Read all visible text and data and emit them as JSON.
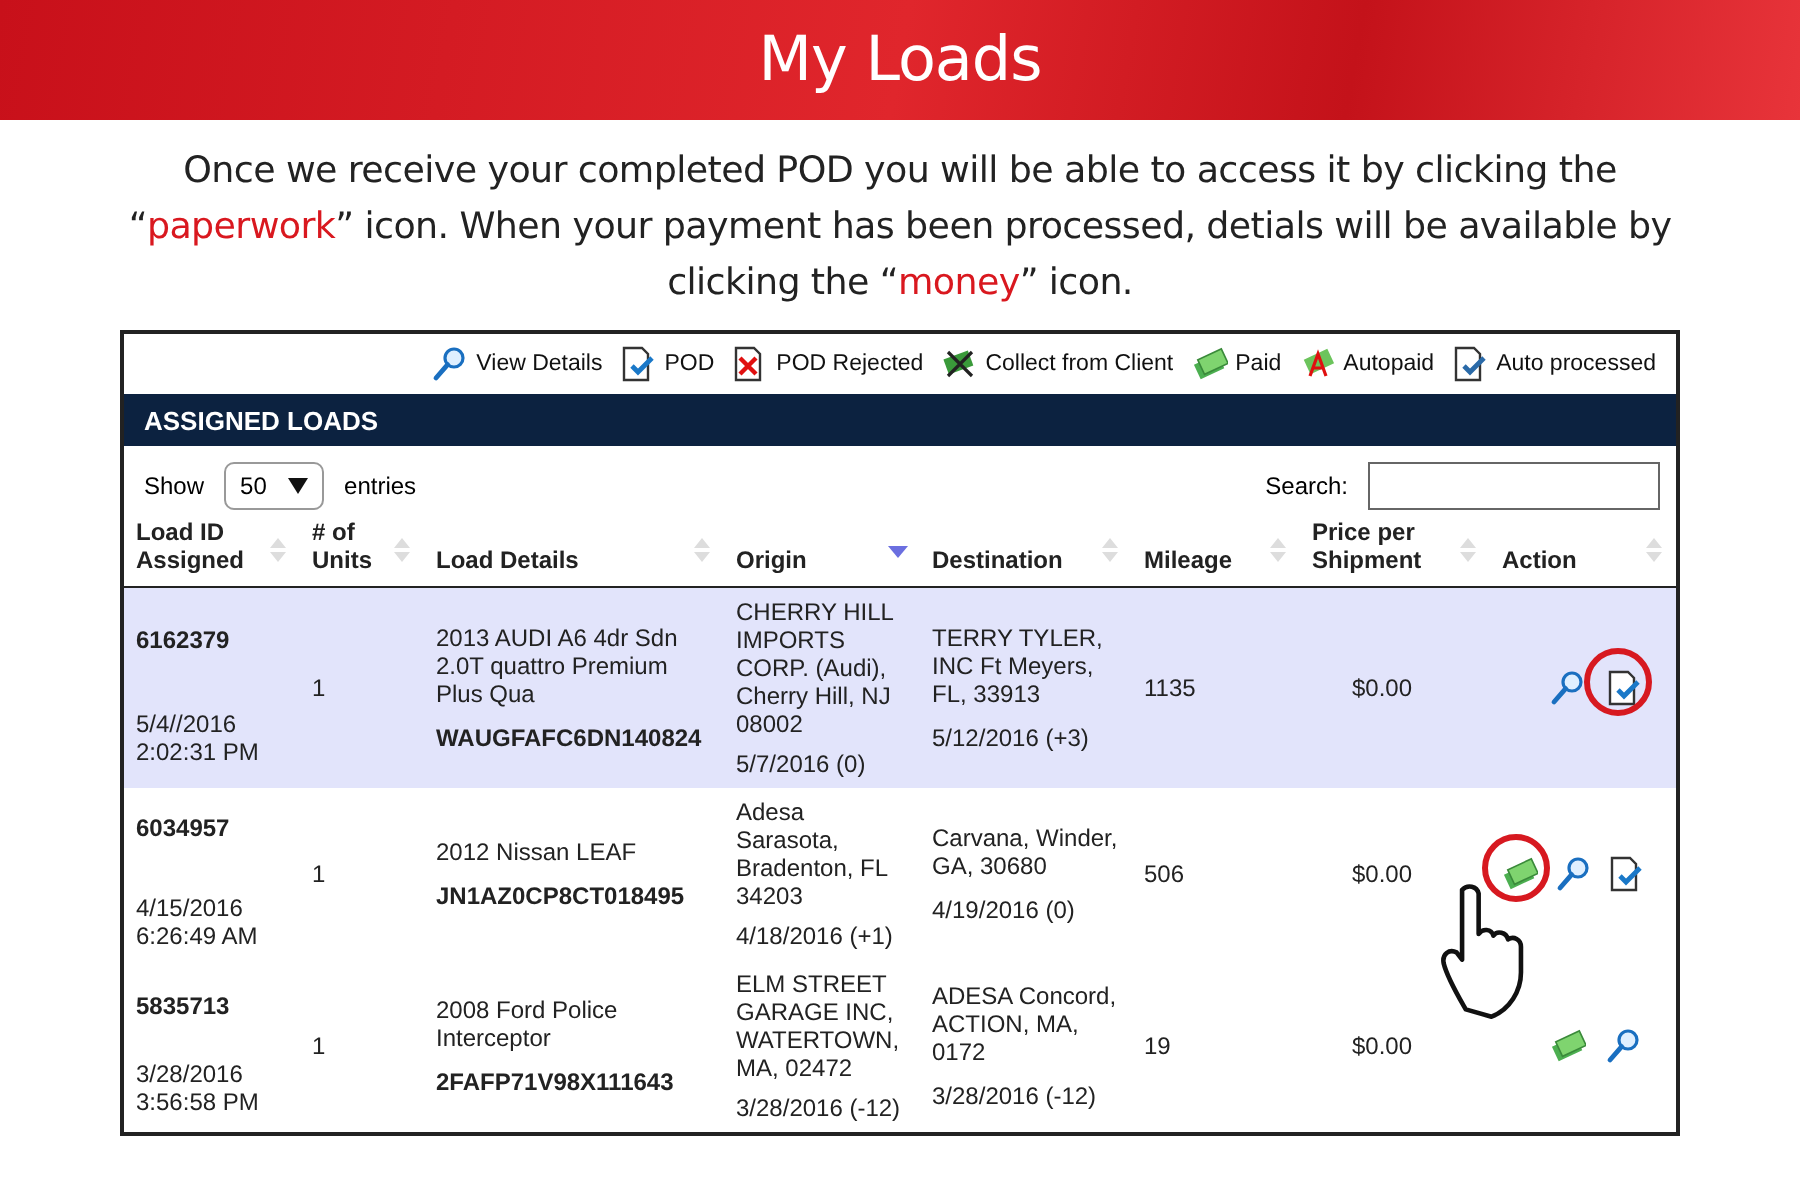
{
  "banner": {
    "title": "My Loads"
  },
  "intro": [
    {
      "text": "Once we receive your completed POD you will be able to access it by clicking the “",
      "highlight": false
    },
    {
      "text": "paperwork",
      "highlight": true
    },
    {
      "text": "” icon. When your payment has been processed, detials will be available by clicking the “",
      "highlight": false
    },
    {
      "text": "money",
      "highlight": true
    },
    {
      "text": "” icon.",
      "highlight": false
    }
  ],
  "legend": [
    {
      "kind": "view",
      "label": "View Details"
    },
    {
      "kind": "pod",
      "label": "POD"
    },
    {
      "kind": "rejected",
      "label": "POD Rejected"
    },
    {
      "kind": "collect",
      "label": "Collect from Client"
    },
    {
      "kind": "paid",
      "label": "Paid"
    },
    {
      "kind": "autopaid",
      "label": "Autopaid"
    },
    {
      "kind": "auto",
      "label": "Auto processed"
    }
  ],
  "panel_title": "ASSIGNED LOADS",
  "length": {
    "show": "Show",
    "value": "50",
    "entries": "entries"
  },
  "search": {
    "label": "Search:"
  },
  "columns": [
    {
      "label": "Load ID Assigned",
      "sorted": false
    },
    {
      "label": "# of Units",
      "sorted": false
    },
    {
      "label": "Load Details",
      "sorted": false
    },
    {
      "label": "Origin",
      "sorted": true
    },
    {
      "label": "Destination",
      "sorted": false
    },
    {
      "label": "Mileage",
      "sorted": false
    },
    {
      "label": "Price per Shipment",
      "sorted": false
    },
    {
      "label": "Action",
      "sorted": false
    }
  ],
  "rows": [
    {
      "selected": true,
      "load_id": "6162379",
      "assigned": "5/4//2016 2:02:31 PM",
      "units": "1",
      "vehicle": "2013 AUDI A6 4dr Sdn 2.0T quattro Premium Plus Qua",
      "vin": "WAUGFAFC6DN140824",
      "origin": "CHERRY HILL IMPORTS CORP. (Audi), Cherry Hill, NJ 08002",
      "origin_date": "5/7/2016 (0)",
      "destination": "TERRY TYLER, INC Ft Meyers, FL, 33913",
      "destination_date": "5/12/2016 (+3)",
      "mileage": "1135",
      "price": "$0.00",
      "pointer": false,
      "actions": [
        {
          "kind": "view",
          "circled": false
        },
        {
          "kind": "pod",
          "circled": true
        }
      ]
    },
    {
      "selected": false,
      "load_id": "6034957",
      "assigned": "4/15/2016 6:26:49 AM",
      "units": "1",
      "vehicle": "2012 Nissan LEAF",
      "vin": "JN1AZ0CP8CT018495",
      "origin": "Adesa Sarasota, Bradenton, FL 34203",
      "origin_date": "4/18/2016 (+1)",
      "destination": "Carvana, Winder, GA, 30680",
      "destination_date": "4/19/2016 (0)",
      "mileage": "506",
      "price": "$0.00",
      "pointer": true,
      "actions": [
        {
          "kind": "paid",
          "circled": true
        },
        {
          "kind": "view",
          "circled": false
        },
        {
          "kind": "pod",
          "circled": false
        }
      ]
    },
    {
      "selected": false,
      "load_id": "5835713",
      "assigned": "3/28/2016 3:56:58 PM",
      "units": "1",
      "vehicle": "2008 Ford Police Interceptor",
      "vin": "2FAFP71V98X111643",
      "origin": "ELM STREET GARAGE INC, WATERTOWN, MA, 02472",
      "origin_date": "3/28/2016 (-12)",
      "destination": "ADESA Concord, ACTION, MA, 0172",
      "destination_date": "3/28/2016 (-12)",
      "mileage": "19",
      "price": "$0.00",
      "pointer": false,
      "actions": [
        {
          "kind": "paid",
          "circled": false
        },
        {
          "kind": "view",
          "circled": false
        }
      ]
    }
  ]
}
